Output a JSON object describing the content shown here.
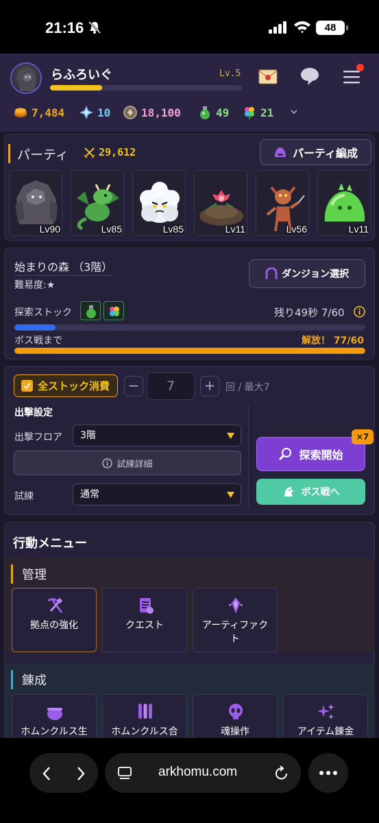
{
  "status_bar": {
    "time": "21:16",
    "battery": "48"
  },
  "player": {
    "name": "らふろいぐ",
    "level": "Lv.5",
    "exp_fraction": 0.27
  },
  "resources": [
    {
      "icon": "gold-coin-icon",
      "value": "7,484",
      "color": "#f2a81d"
    },
    {
      "icon": "blue-crystal-icon",
      "value": "10",
      "color": "#7ec8f5"
    },
    {
      "icon": "soul-orb-icon",
      "value": "18,100",
      "color": "#f0a3d4"
    },
    {
      "icon": "green-potion-icon",
      "value": "49",
      "color": "#8fe08a"
    },
    {
      "icon": "clover-icon",
      "value": "21",
      "color": "#8fe08a"
    }
  ],
  "party": {
    "title": "パーティ",
    "power": "29,612",
    "edit_label": "パーティ編成",
    "members": [
      {
        "name": "stone-golem",
        "level": "Lv90"
      },
      {
        "name": "green-dragon",
        "level": "Lv85"
      },
      {
        "name": "cloud-puff",
        "level": "Lv85"
      },
      {
        "name": "flower-mound",
        "level": "Lv11"
      },
      {
        "name": "imp",
        "level": "Lv56"
      },
      {
        "name": "green-slime",
        "level": "Lv11"
      }
    ]
  },
  "dungeon": {
    "name": "始まりの森 （3階）",
    "difficulty": "難易度:★",
    "select_label": "ダンジョン選択",
    "stock_label": "探索ストック",
    "stock_timer": "残り49秒 7/60",
    "stock_fraction": 0.117,
    "boss_label": "ボス戦まで",
    "boss_value": "解放！ 77/60",
    "boss_fraction": 1.0
  },
  "sortie": {
    "all_stock_label": "全ストック消費",
    "minus": "−",
    "count": "7",
    "plus": "+",
    "unit": "回 / 最大7",
    "settings_title": "出撃設定",
    "floor_label": "出撃フロア",
    "floor_value": "3階",
    "detail_label": "試練詳細",
    "trial_label": "試練",
    "trial_value": "通常",
    "explore_label": "探索開始",
    "explore_badge": "×7",
    "boss_label": "ボス戦へ"
  },
  "actions": {
    "title": "行動メニュー",
    "categories": [
      {
        "title": "管理",
        "color": "#e7a627",
        "items": [
          {
            "label": "拠点の強化",
            "icon": "hammer-pick-icon"
          },
          {
            "label": "クエスト",
            "icon": "quest-scroll-icon"
          },
          {
            "label": "アーティファクト",
            "icon": "artifact-crystal-icon"
          }
        ]
      },
      {
        "title": "錬成",
        "color": "#4aa7c8",
        "items": [
          {
            "label": "ホムンクルス生",
            "icon": "cauldron-icon"
          },
          {
            "label": "ホムンクルス合",
            "icon": "test-tubes-icon"
          },
          {
            "label": "魂操作",
            "icon": "soul-skull-icon"
          },
          {
            "label": "アイテム錬金",
            "icon": "sparkles-icon"
          }
        ]
      }
    ]
  },
  "browser": {
    "url": "arkhomu.com"
  }
}
